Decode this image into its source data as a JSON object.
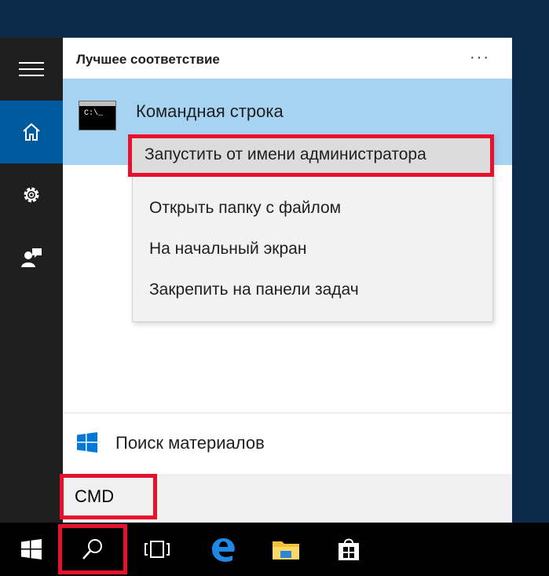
{
  "start_menu": {
    "section_title": "Лучшее соответствие",
    "more_label": "···",
    "best_match": {
      "app_name": "Командная строка",
      "icon_text": "C:\\_"
    },
    "context_menu": [
      {
        "label": "Запустить от имени администратора",
        "highlighted": true
      },
      {
        "label": "Открыть папку с файлом",
        "highlighted": false
      },
      {
        "label": "На начальный экран",
        "highlighted": false
      },
      {
        "label": "Закрепить на панели задач",
        "highlighted": false
      }
    ],
    "search_web_label": "Поиск материалов",
    "search_value": "CMD"
  },
  "rail": [
    "hamburger-icon",
    "home-icon",
    "gear-icon",
    "user-feedback-icon"
  ],
  "taskbar": [
    "windows-start-icon",
    "search-icon",
    "task-view-icon",
    "edge-icon",
    "file-explorer-icon",
    "store-icon"
  ],
  "colors": {
    "accent": "#005a9e",
    "highlight_border": "#e8112d",
    "best_match_bg": "#a6d3f2"
  }
}
